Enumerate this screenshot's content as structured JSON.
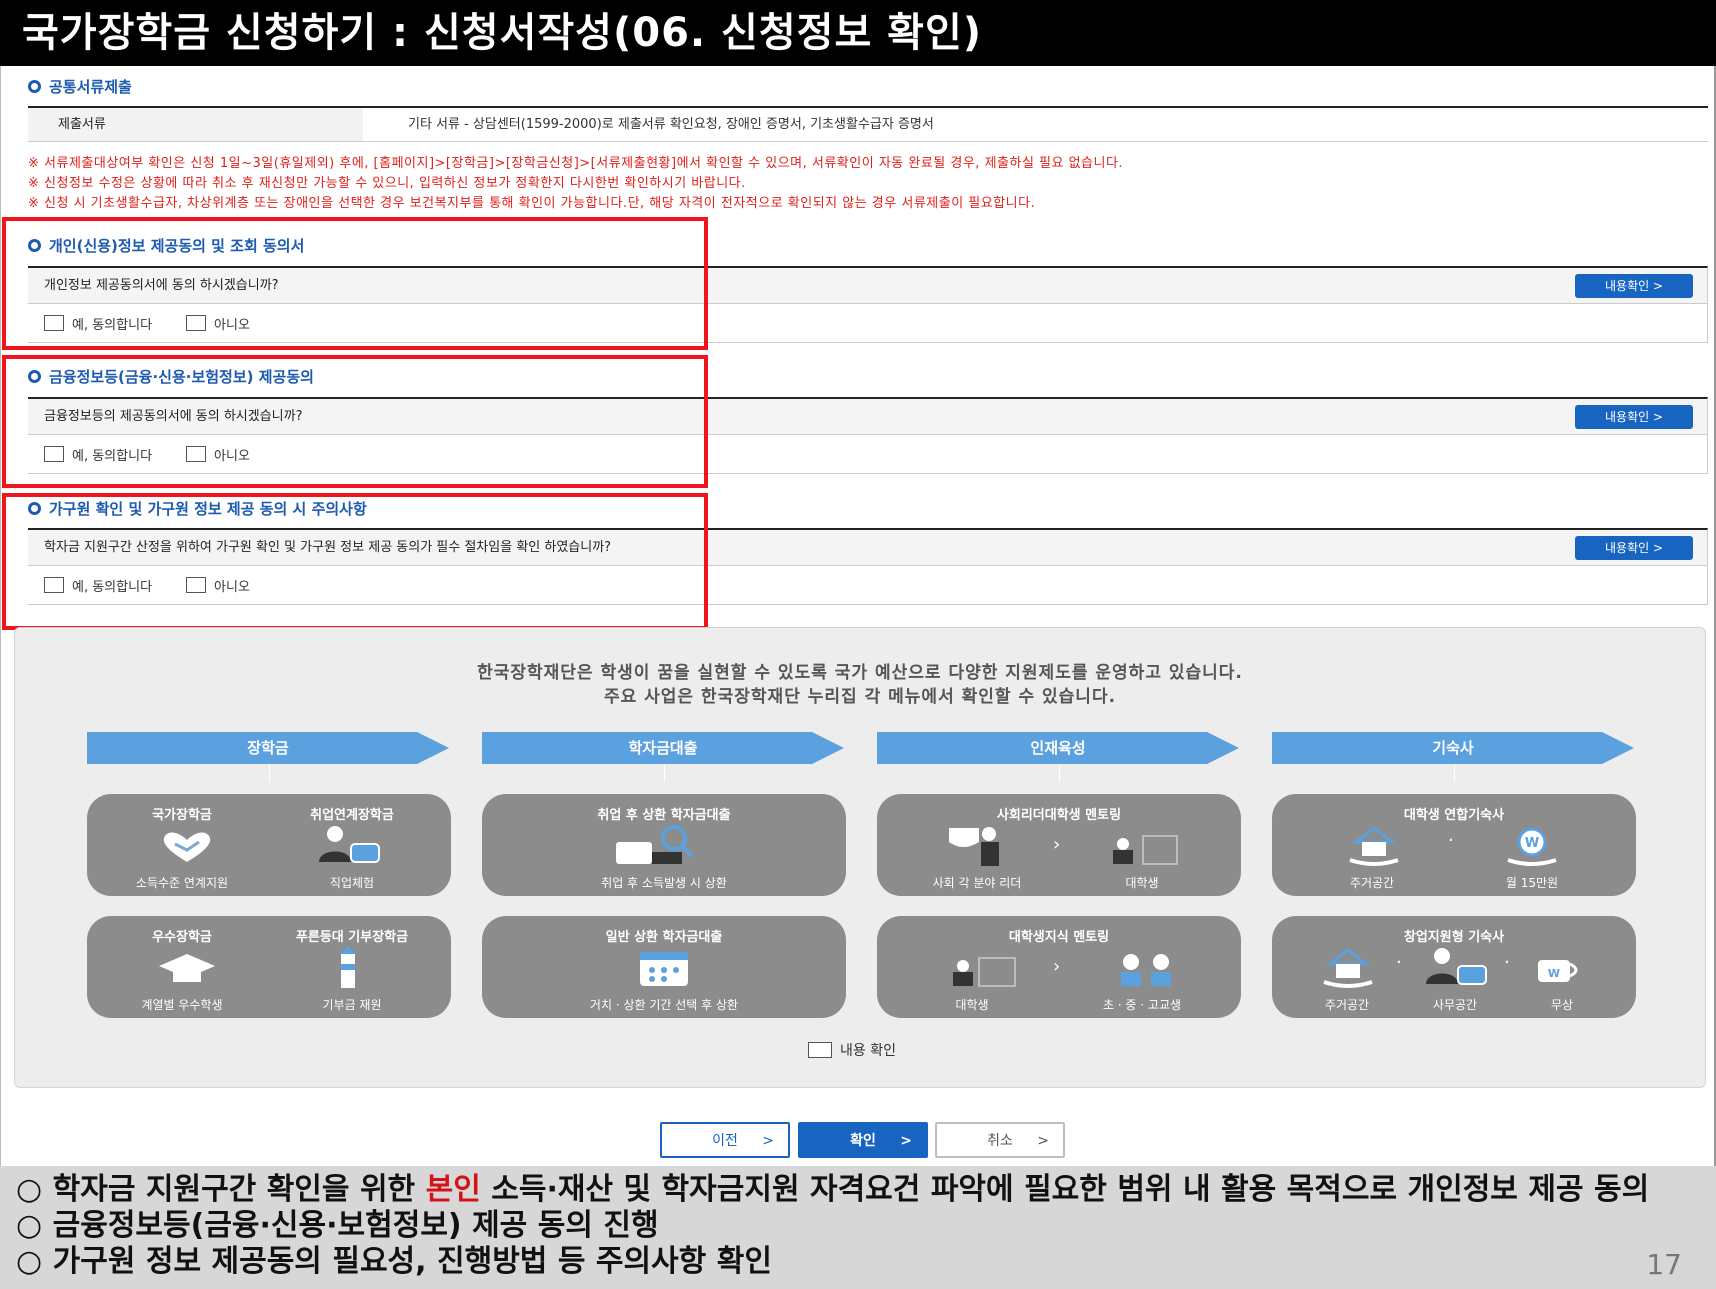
{
  "header": {
    "title": "국가장학금 신청하기 : 신청서작성(06. 신청정보 확인)"
  },
  "documents": {
    "section_title": "공통서류제출",
    "label": "제출서류",
    "value": "기타 서류 - 상담센터(1599-2000)로 제출서류 확인요청, 장애인 증명서, 기초생활수급자 증명서"
  },
  "notices": [
    "※ 서류제출대상여부 확인은 신청 1일~3일(휴일제외) 후에, [홈페이지]>[장학금]>[장학금신청]>[서류제출현황]에서 확인할 수 있으며, 서류확인이 자동 완료될 경우, 제출하실 필요 없습니다.",
    "※ 신청정보 수정은 상황에 따라 취소 후 재신청만 가능할 수 있으니, 입력하신 정보가 정확한지 다시한번 확인하시기 바랍니다.",
    "※ 신청 시 기초생활수급자, 차상위계층 또는 장애인을 선택한 경우 보건복지부를 통해 확인이 가능합니다.단, 해당 자격이 전자적으로 확인되지 않는 경우 서류제출이 필요합니다."
  ],
  "consents": [
    {
      "title": "개인(신용)정보 제공동의 및 조회 동의서",
      "question": "개인정보 제공동의서에 동의 하시겠습니까?",
      "yes": "예, 동의합니다",
      "no": "아니오",
      "button": "내용확인  >"
    },
    {
      "title": "금융정보등(금융·신용·보험정보) 제공동의",
      "question": "금융정보등의 제공동의서에 동의 하시겠습니까?",
      "yes": "예, 동의합니다",
      "no": "아니오",
      "button": "내용확인  >"
    },
    {
      "title": "가구원 확인 및 가구원 정보 제공 동의 시 주의사항",
      "question": "학자금 지원구간 산정을 위하여 가구원 확인 및 가구원 정보 제공 동의가 필수 절차임을 확인 하였습니까?",
      "yes": "예, 동의합니다",
      "no": "아니오",
      "button": "내용확인  >"
    }
  ],
  "info_panel": {
    "line1": "한국장학재단은 학생이 꿈을 실현할 수 있도록 국가 예산으로 다양한 지원제도를 운영하고 있습니다.",
    "line2": "주요 사업은 한국장학재단 누리집 각 메뉴에서 확인할 수 있습니다.",
    "categories": [
      "장학금",
      "학자금대출",
      "인재육성",
      "기숙사"
    ],
    "tiles": {
      "scholar_top": {
        "l1": "국가장학금",
        "l2": "취업연계장학금",
        "c1": "소득수준 연계지원",
        "c2": "직업체험"
      },
      "scholar_bottom": {
        "l1": "우수장학금",
        "l2": "푸른등대 기부장학금",
        "c1": "계열별 우수학생",
        "c2": "기부금 재원"
      },
      "loan_top": {
        "l1": "취업 후 상환 학자금대출",
        "c1": "취업 후 소득발생 시 상환"
      },
      "loan_bottom": {
        "l1": "일반 상환 학자금대출",
        "c1": "거치 · 상환 기간 선택 후 상환"
      },
      "talent_top": {
        "l1": "사회리더대학생 멘토링",
        "c1": "사회 각 분야 리더",
        "c2": "대학생"
      },
      "talent_bottom": {
        "l1": "대학생지식 멘토링",
        "c1": "대학생",
        "c2": "초 · 중 · 고교생"
      },
      "dorm_top": {
        "l1": "대학생 연합기숙사",
        "c1": "주거공간",
        "c2": "월 15만원"
      },
      "dorm_bottom": {
        "l1": "창업지원형 기숙사",
        "c1": "주거공간",
        "c2": "사무공간",
        "c3": "무상"
      }
    },
    "content_check": "내용 확인"
  },
  "buttons": {
    "prev": "이전",
    "ok": "확인",
    "cancel": "취소",
    "chevron": ">"
  },
  "footer": {
    "line1_prefix": "○ 학자금 지원구간 확인을 위한 ",
    "line1_highlight": "본인",
    "line1_suffix": " 소득·재산 및 학자금지원 자격요건 파악에 필요한 범위 내 활용 목적으로 개인정보 제공 동의",
    "line2": "○ 금융정보등(금융·신용·보험정보) 제공 동의 진행",
    "line3": "○ 가구원 정보 제공동의 필요성, 진행방법 등 주의사항 확인",
    "page": "17"
  },
  "colors": {
    "accent": "#1765c1",
    "highlight_red": "#f0151a",
    "notice_red": "#e0201b",
    "tile_gray": "#8c8c8c",
    "arrow_blue": "#5ba0df"
  }
}
